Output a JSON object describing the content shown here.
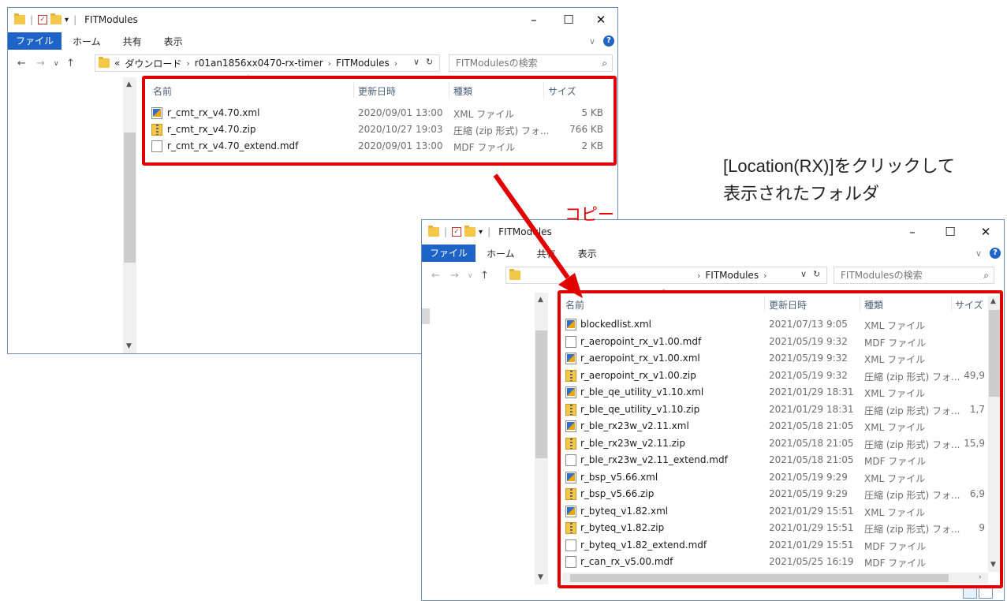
{
  "window1": {
    "title": "FITModules",
    "tabs": [
      "ファイル",
      "ホーム",
      "共有",
      "表示"
    ],
    "address": {
      "overflow": "«",
      "segments": [
        "ダウンロード",
        "r01an1856xx0470-rx-timer",
        "FITModules"
      ]
    },
    "search_placeholder": "FITModulesの検索",
    "columns": [
      "名前",
      "更新日時",
      "種類",
      "サイズ"
    ],
    "files": [
      {
        "icon": "xml-file-icon",
        "name": "r_cmt_rx_v4.70.xml",
        "date": "2020/09/01 13:00",
        "type": "XML ファイル",
        "size": "5 KB"
      },
      {
        "icon": "zip-file-icon",
        "name": "r_cmt_rx_v4.70.zip",
        "date": "2020/10/27 19:03",
        "type": "圧縮 (zip 形式) フォ...",
        "size": "766 KB"
      },
      {
        "icon": "mdf-file-icon",
        "name": "r_cmt_rx_v4.70_extend.mdf",
        "date": "2020/09/01 13:00",
        "type": "MDF ファイル",
        "size": "2 KB"
      }
    ]
  },
  "window2": {
    "title": "FITModules",
    "tabs": [
      "ファイル",
      "ホーム",
      "共有",
      "表示"
    ],
    "address": {
      "segments": [
        "FITModules"
      ]
    },
    "search_placeholder": "FITModulesの検索",
    "columns": [
      "名前",
      "更新日時",
      "種類",
      "サイズ"
    ],
    "files": [
      {
        "icon": "xml-file-icon",
        "name": "blockedlist.xml",
        "date": "2021/07/13 9:05",
        "type": "XML ファイル",
        "size": ""
      },
      {
        "icon": "mdf-file-icon",
        "name": "r_aeropoint_rx_v1.00.mdf",
        "date": "2021/05/19 9:32",
        "type": "MDF ファイル",
        "size": ""
      },
      {
        "icon": "xml-file-icon",
        "name": "r_aeropoint_rx_v1.00.xml",
        "date": "2021/05/19 9:32",
        "type": "XML ファイル",
        "size": ""
      },
      {
        "icon": "zip-file-icon",
        "name": "r_aeropoint_rx_v1.00.zip",
        "date": "2021/05/19 9:32",
        "type": "圧縮 (zip 形式) フォ...",
        "size": "49,9"
      },
      {
        "icon": "xml-file-icon",
        "name": "r_ble_qe_utility_v1.10.xml",
        "date": "2021/01/29 18:31",
        "type": "XML ファイル",
        "size": ""
      },
      {
        "icon": "zip-file-icon",
        "name": "r_ble_qe_utility_v1.10.zip",
        "date": "2021/01/29 18:31",
        "type": "圧縮 (zip 形式) フォ...",
        "size": "1,7"
      },
      {
        "icon": "xml-file-icon",
        "name": "r_ble_rx23w_v2.11.xml",
        "date": "2021/05/18 21:05",
        "type": "XML ファイル",
        "size": ""
      },
      {
        "icon": "zip-file-icon",
        "name": "r_ble_rx23w_v2.11.zip",
        "date": "2021/05/18 21:05",
        "type": "圧縮 (zip 形式) フォ...",
        "size": "15,9"
      },
      {
        "icon": "mdf-file-icon",
        "name": "r_ble_rx23w_v2.11_extend.mdf",
        "date": "2021/05/18 21:05",
        "type": "MDF ファイル",
        "size": ""
      },
      {
        "icon": "xml-file-icon",
        "name": "r_bsp_v5.66.xml",
        "date": "2021/05/19 9:29",
        "type": "XML ファイル",
        "size": ""
      },
      {
        "icon": "zip-file-icon",
        "name": "r_bsp_v5.66.zip",
        "date": "2021/05/19 9:29",
        "type": "圧縮 (zip 形式) フォ...",
        "size": "6,9"
      },
      {
        "icon": "xml-file-icon",
        "name": "r_byteq_v1.82.xml",
        "date": "2021/01/29 15:51",
        "type": "XML ファイル",
        "size": ""
      },
      {
        "icon": "zip-file-icon",
        "name": "r_byteq_v1.82.zip",
        "date": "2021/01/29 15:51",
        "type": "圧縮 (zip 形式) フォ...",
        "size": "9"
      },
      {
        "icon": "mdf-file-icon",
        "name": "r_byteq_v1.82_extend.mdf",
        "date": "2021/01/29 15:51",
        "type": "MDF ファイル",
        "size": ""
      },
      {
        "icon": "mdf-file-icon",
        "name": "r_can_rx_v5.00.mdf",
        "date": "2021/05/25 16:19",
        "type": "MDF ファイル",
        "size": ""
      }
    ]
  },
  "annotations": {
    "callout_line1": "[Location(RX)]をクリックして",
    "callout_line2": "表示されたフォルダ",
    "copy_label": "コピー",
    "accent": "#e00000"
  }
}
